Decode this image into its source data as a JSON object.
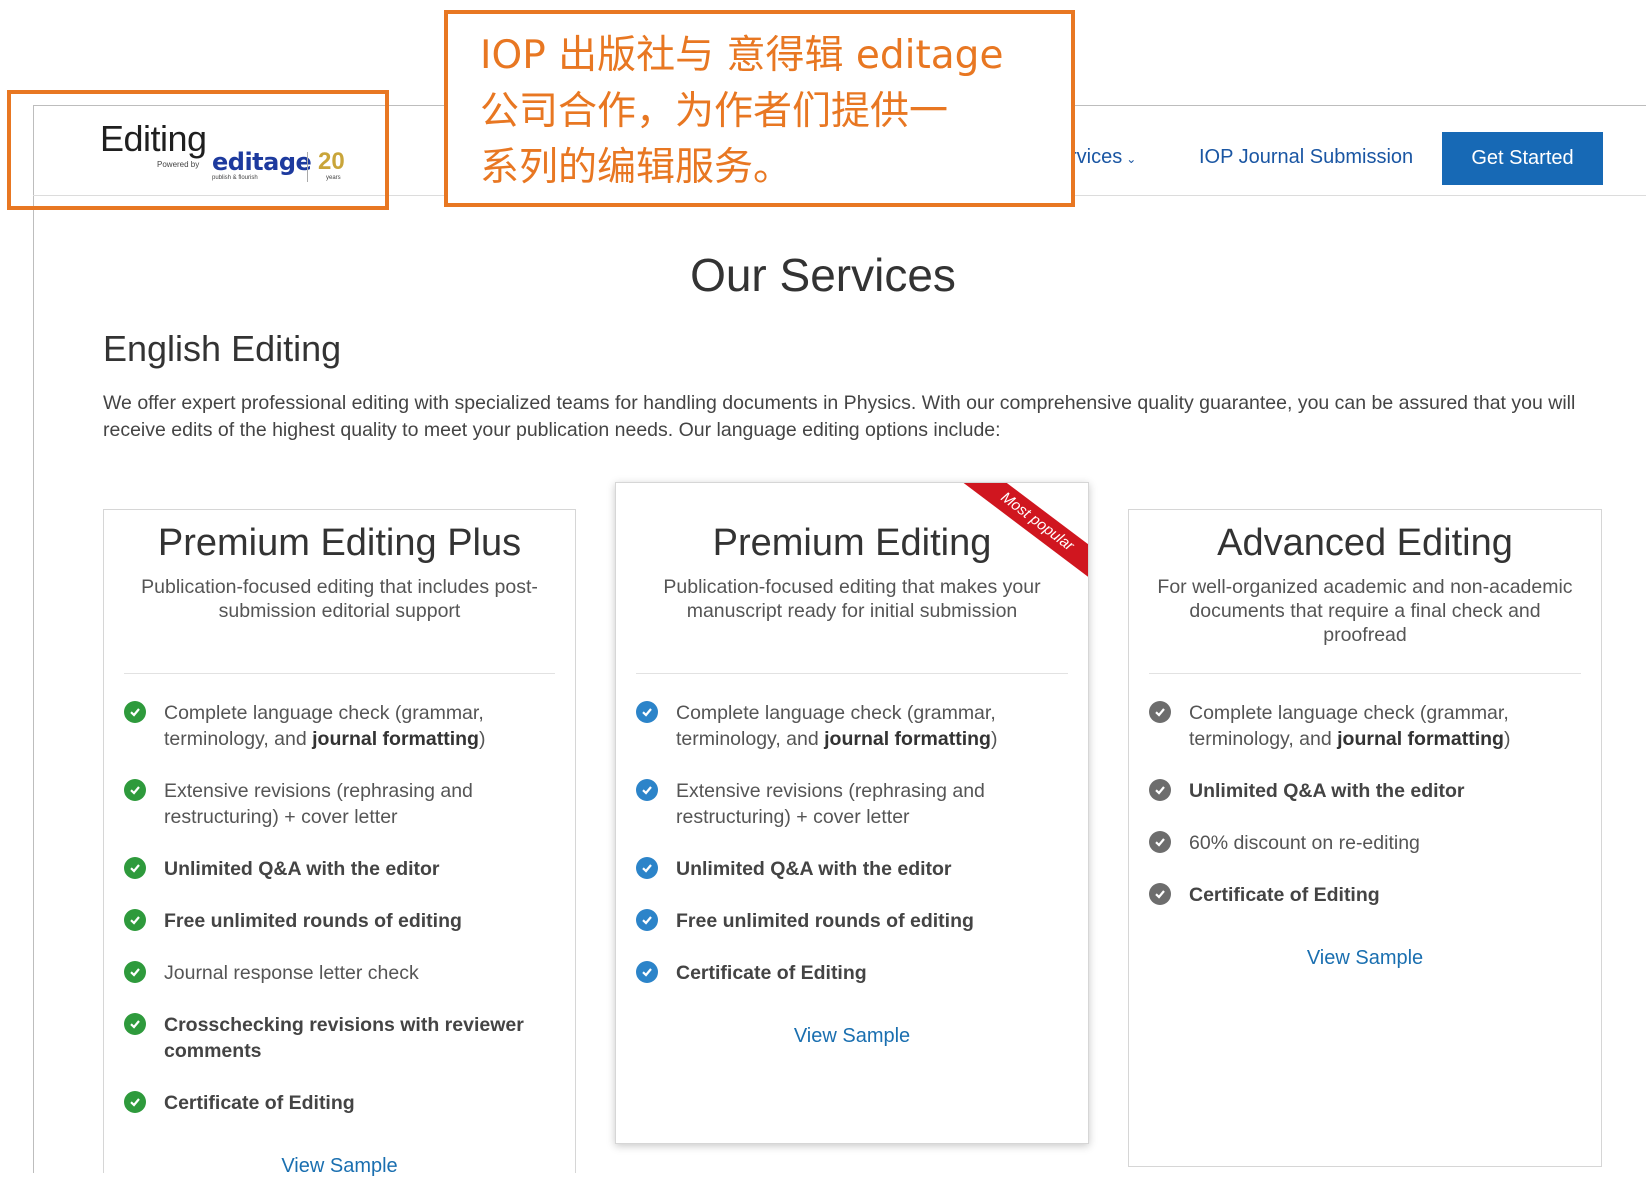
{
  "header": {
    "logo": {
      "wordmark": "Editing",
      "powered_by": "Powered by",
      "brand": "editage",
      "tagline": "publish & flourish",
      "anniversary": "20",
      "anniversary_unit": "years"
    },
    "nav": {
      "services_label": "rvices",
      "submission_label": "IOP Journal Submission",
      "cta_label": "Get Started"
    }
  },
  "annotation": {
    "accent": "#e87722",
    "lines": [
      "IOP 出版社与 意得辑 editage",
      "公司合作，为作者们提供一",
      "系列的编辑服务。"
    ]
  },
  "main": {
    "title": "Our Services",
    "section_heading": "English Editing",
    "intro": "We offer expert professional editing with specialized teams for handling documents in Physics. With our comprehensive quality guarantee, you can be assured that you will receive edits of the highest quality to meet your publication needs. Our language editing options include:"
  },
  "cards": [
    {
      "title": "Premium Editing Plus",
      "description": "Publication-focused editing that includes post-submission editorial support",
      "check_color": "#2e9a3c",
      "features": [
        {
          "pre": "Complete language check (grammar, terminology, and ",
          "bold": "journal formatting",
          "post": ")"
        },
        {
          "text": "Extensive revisions (rephrasing and restructuring) + cover letter"
        },
        {
          "strong": "Unlimited Q&A with the editor"
        },
        {
          "strong": "Free unlimited rounds of editing"
        },
        {
          "text": "Journal response letter check"
        },
        {
          "strong": "Crosschecking revisions with reviewer comments"
        },
        {
          "strong": "Certificate of Editing"
        }
      ],
      "link": "View Sample"
    },
    {
      "title": "Premium Editing",
      "badge": "Most popular",
      "description": "Publication-focused editing that makes your manuscript ready for initial submission",
      "check_color": "#2c84c9",
      "features": [
        {
          "pre": "Complete language check (grammar, terminology, and ",
          "bold": "journal formatting",
          "post": ")"
        },
        {
          "text": "Extensive revisions (rephrasing and restructuring) + cover letter"
        },
        {
          "strong": "Unlimited Q&A with the editor"
        },
        {
          "strong": "Free unlimited rounds of editing"
        },
        {
          "strong": "Certificate of Editing"
        }
      ],
      "link": "View Sample"
    },
    {
      "title": "Advanced Editing",
      "description": "For well-organized academic and non-academic documents that require a final check and proofread",
      "check_color": "#6d6d6d",
      "features": [
        {
          "pre": "Complete language check (grammar, terminology, and ",
          "bold": "journal formatting",
          "post": ")"
        },
        {
          "strong": "Unlimited Q&A with the editor"
        },
        {
          "text": "60% discount on re-editing"
        },
        {
          "strong": "Certificate of Editing"
        }
      ],
      "link": "View Sample"
    }
  ]
}
